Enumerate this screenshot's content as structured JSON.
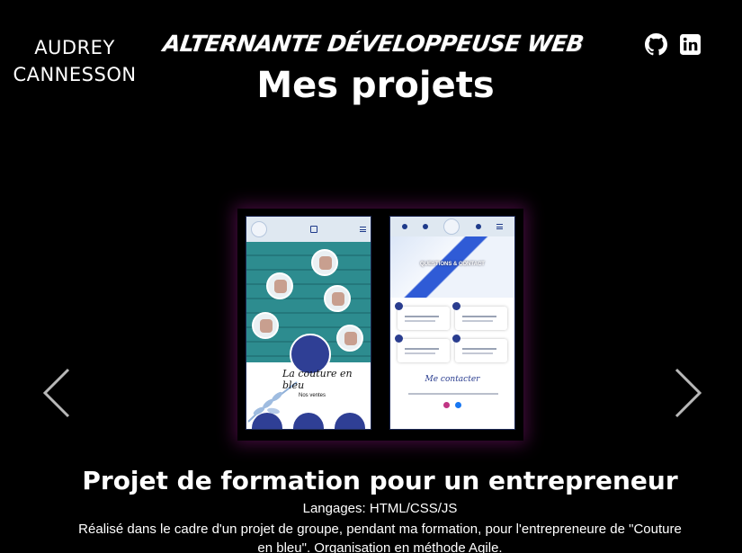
{
  "header": {
    "author_line1": "AUDREY",
    "author_line2": "CANNESSON",
    "tagline": "ALTERNANTE DÉVELOPPEUSE WEB",
    "social": [
      {
        "icon": "github-icon"
      },
      {
        "icon": "linkedin-icon"
      }
    ]
  },
  "main": {
    "title": "Mes projets"
  },
  "carousel": {
    "prev_icon": "chevron-left-icon",
    "next_icon": "chevron-right-icon",
    "slide": {
      "phone_a": {
        "brand": "La couture en bleu",
        "sub": "Nos ventes"
      },
      "phone_b": {
        "hero_title": "QUESTIONS & CONTACT",
        "contact": "Me contacter"
      }
    }
  },
  "project": {
    "title": "Projet de formation pour un entrepreneur",
    "languages": "Langages: HTML/CSS/JS",
    "description": "Réalisé dans le cadre d'un projet de groupe, pendant ma formation, pour l'entrepreneure de \"Couture en bleu\". Organisation en méthode Agile."
  },
  "colors": {
    "background": "#000000",
    "text": "#ffffff",
    "glow": "#78146e",
    "brand_blue": "#2f3f95",
    "teal": "#2d8c8f"
  }
}
